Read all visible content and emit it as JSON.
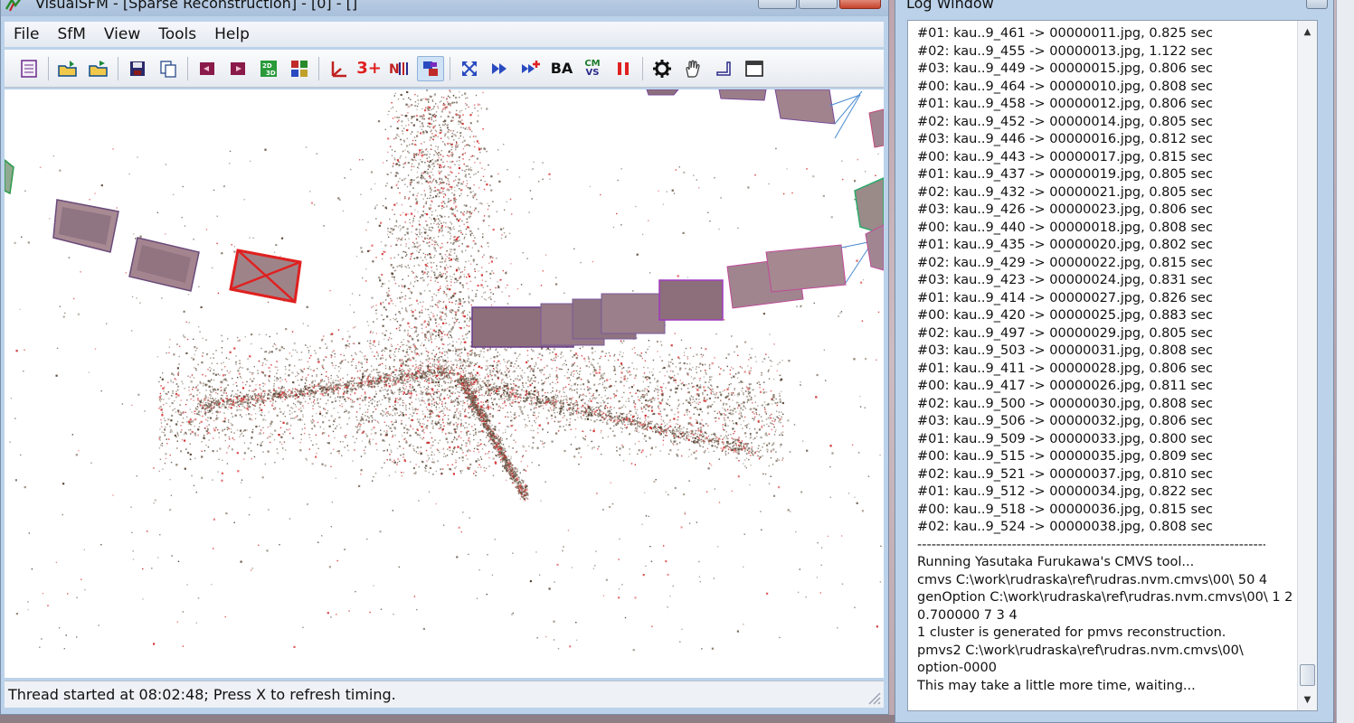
{
  "app": {
    "title": "VisualSFM - [Sparse Reconstruction] - [0] - []"
  },
  "menu": [
    "File",
    "SfM",
    "View",
    "Tools",
    "Help"
  ],
  "toolbar": {
    "icons": [
      "new-window-icon",
      "open-folder-icon",
      "open-multi-folder-icon",
      "save-icon",
      "copy-icon",
      "prev-icon",
      "next-icon",
      "2d-3d-toggle-icon",
      "grid-view-icon",
      "axes-icon",
      "3plus-icon",
      "match-icon",
      "pair-view-icon",
      "compute-missing-match-icon",
      "reconstruct-icon",
      "reconstruct-resume-icon",
      "bundle-adjust-icon",
      "cmvs-icon",
      "pause-icon",
      "settings-icon",
      "hand-icon",
      "ruler-icon",
      "window-icon"
    ],
    "label_3plus": "3+",
    "label_ba": "BA",
    "label_cmvs_top": "CM",
    "label_cmvs_bottom": "VS"
  },
  "status": {
    "text": "Thread started at 08:02:48; Press X to refresh timing."
  },
  "log": {
    "title": "Log Window",
    "lines": [
      "#01: kau..9_461 -> 00000011.jpg, 0.825 sec",
      "#02: kau..9_455 -> 00000013.jpg, 1.122 sec",
      "#03: kau..9_449 -> 00000015.jpg, 0.806 sec",
      "#00: kau..9_464 -> 00000010.jpg, 0.808 sec",
      "#01: kau..9_458 -> 00000012.jpg, 0.806 sec",
      "#02: kau..9_452 -> 00000014.jpg, 0.805 sec",
      "#03: kau..9_446 -> 00000016.jpg, 0.812 sec",
      "#00: kau..9_443 -> 00000017.jpg, 0.815 sec",
      "#01: kau..9_437 -> 00000019.jpg, 0.805 sec",
      "#02: kau..9_432 -> 00000021.jpg, 0.805 sec",
      "#03: kau..9_426 -> 00000023.jpg, 0.806 sec",
      "#00: kau..9_440 -> 00000018.jpg, 0.808 sec",
      "#01: kau..9_435 -> 00000020.jpg, 0.802 sec",
      "#02: kau..9_429 -> 00000022.jpg, 0.815 sec",
      "#03: kau..9_423 -> 00000024.jpg, 0.831 sec",
      "#01: kau..9_414 -> 00000027.jpg, 0.826 sec",
      "#00: kau..9_420 -> 00000025.jpg, 0.883 sec",
      "#02: kau..9_497 -> 00000029.jpg, 0.805 sec",
      "#03: kau..9_503 -> 00000031.jpg, 0.808 sec",
      "#01: kau..9_411 -> 00000028.jpg, 0.806 sec",
      "#00: kau..9_417 -> 00000026.jpg, 0.811 sec",
      "#02: kau..9_500 -> 00000030.jpg, 0.808 sec",
      "#03: kau..9_506 -> 00000032.jpg, 0.806 sec",
      "#01: kau..9_509 -> 00000033.jpg, 0.800 sec",
      "#00: kau..9_515 -> 00000035.jpg, 0.809 sec",
      "#02: kau..9_521 -> 00000037.jpg, 0.810 sec",
      "#01: kau..9_512 -> 00000034.jpg, 0.822 sec",
      "#00: kau..9_518 -> 00000036.jpg, 0.815 sec",
      "#02: kau..9_524 -> 00000038.jpg, 0.808 sec"
    ],
    "divider": "----------------------------------------------------------------------------",
    "tail": [
      "Running Yasutaka Furukawa's CMVS tool...",
      "cmvs C:\\work\\rudraska\\ref\\rudras.nvm.cmvs\\00\\ 50 4",
      "genOption C:\\work\\rudraska\\ref\\rudras.nvm.cmvs\\00\\ 1 2",
      "0.700000 7 3 4",
      "1 cluster is generated for pmvs reconstruction.",
      "pmvs2 C:\\work\\rudraska\\ref\\rudras.nvm.cmvs\\00\\",
      "option-0000",
      "This may take a little more time, waiting..."
    ]
  },
  "colors": {
    "accent": "#bcd2ea",
    "failed_camera": "#e02020",
    "point_dark": "#5a4a3a",
    "point_red": "#d22a2a"
  }
}
